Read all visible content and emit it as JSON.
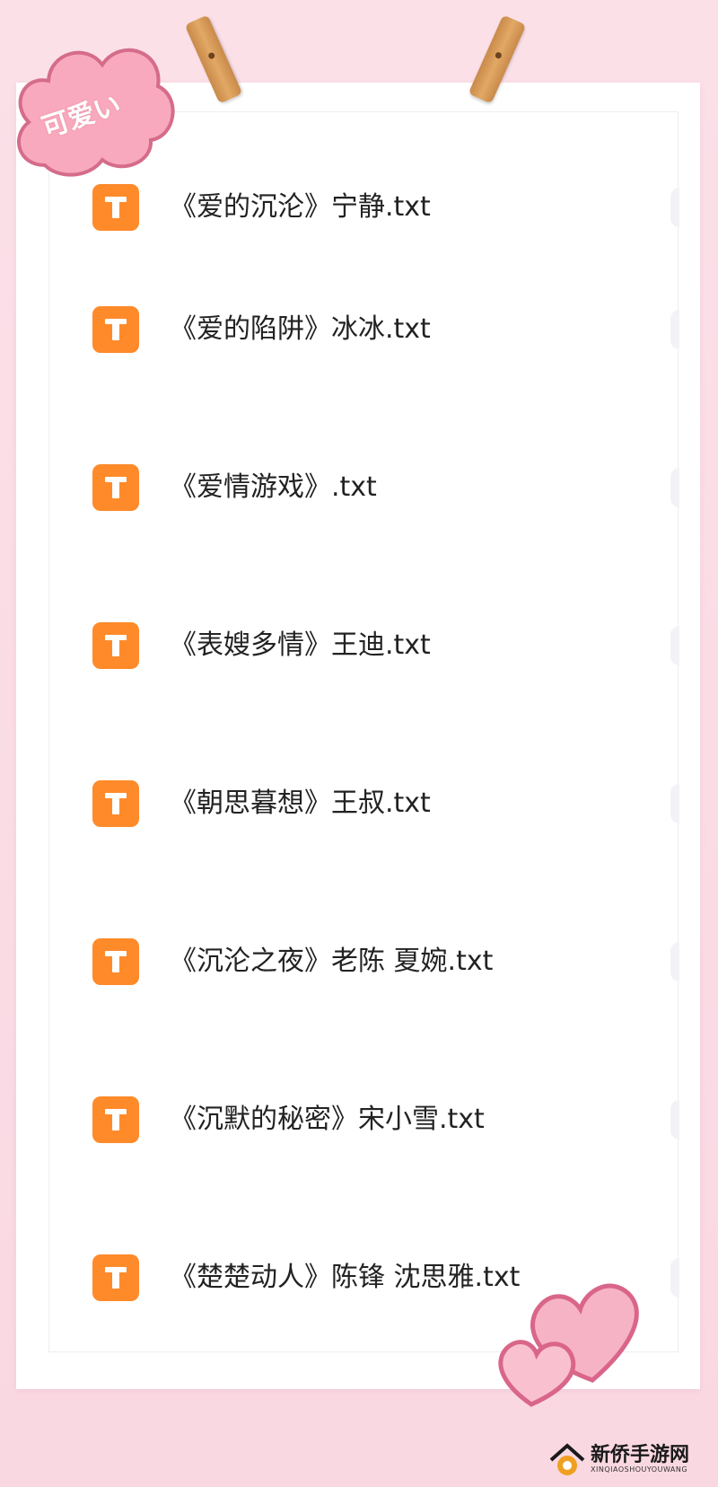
{
  "sticker": {
    "label": "可爱い"
  },
  "files": [
    {
      "name": "《爱的沉沦》宁静.txt",
      "icon": "txt-file-icon",
      "icon_letter": "T"
    },
    {
      "name": "《爱的陷阱》冰冰.txt",
      "icon": "txt-file-icon",
      "icon_letter": "T"
    },
    {
      "name": "《爱情游戏》.txt",
      "icon": "txt-file-icon",
      "icon_letter": "T"
    },
    {
      "name": "《表嫂多情》王迪.txt",
      "icon": "txt-file-icon",
      "icon_letter": "T"
    },
    {
      "name": "《朝思暮想》王叔.txt",
      "icon": "txt-file-icon",
      "icon_letter": "T"
    },
    {
      "name": "《沉沦之夜》老陈 夏婉.txt",
      "icon": "txt-file-icon",
      "icon_letter": "T"
    },
    {
      "name": "《沉默的秘密》宋小雪.txt",
      "icon": "txt-file-icon",
      "icon_letter": "T"
    },
    {
      "name": "《楚楚动人》陈锋 沈思雅.txt",
      "icon": "txt-file-icon",
      "icon_letter": "T"
    }
  ],
  "watermark": {
    "title": "新侨手游网",
    "subtitle": "XINQIAOSHOUYOUWANG"
  },
  "colors": {
    "icon_bg": "#ff8a2a",
    "page_bg": "#fbdde6",
    "paper": "#ffffff"
  }
}
